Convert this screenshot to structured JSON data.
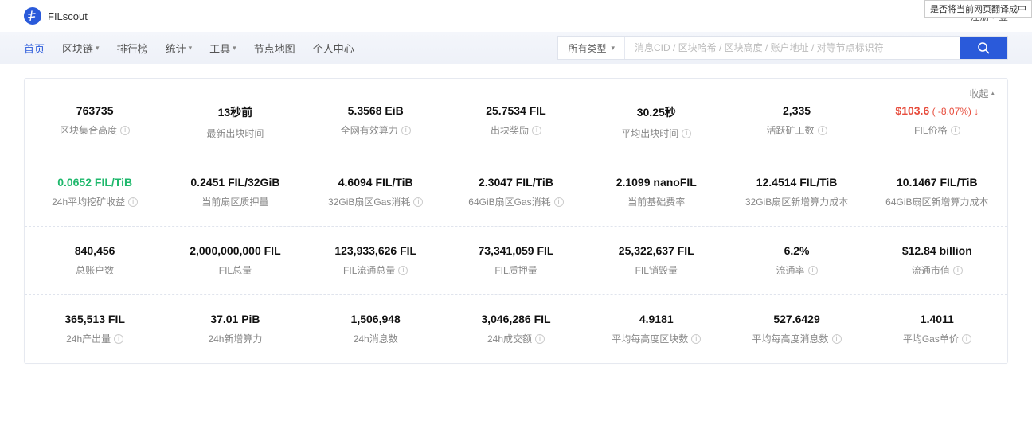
{
  "brand": {
    "name": "FILscout",
    "logo_glyph": "Ⓕ"
  },
  "top_right": {
    "register": "注册",
    "login": "登",
    "separator": "/"
  },
  "translate_prompt": "是否将当前网页翻译成中",
  "nav": {
    "home": "首页",
    "blockchain": "区块链",
    "leaderboard": "排行榜",
    "stats": "统计",
    "tools": "工具",
    "node_map": "节点地图",
    "personal": "个人中心"
  },
  "search": {
    "type_label": "所有类型",
    "placeholder": "消息CID / 区块哈希 / 区块高度 / 账户地址 / 对等节点标识符"
  },
  "collapse": {
    "label": "收起"
  },
  "stats": {
    "row1": [
      {
        "value": "763735",
        "label": "区块集合高度",
        "info": true
      },
      {
        "value": "13秒前",
        "label": "最新出块时间",
        "info": false
      },
      {
        "value": "5.3568 EiB",
        "label": "全网有效算力",
        "info": true
      },
      {
        "value": "25.7534 FIL",
        "label": "出块奖励",
        "info": true
      },
      {
        "value": "30.25秒",
        "label": "平均出块时间",
        "info": true
      },
      {
        "value": "2,335",
        "label": "活跃矿工数",
        "info": true
      },
      {
        "value": "$103.6",
        "pct": "( -8.07%) ↓",
        "label": "FIL价格",
        "info": true,
        "price": true
      }
    ],
    "row2": [
      {
        "value": "0.0652 FIL/TiB",
        "label": "24h平均挖矿收益",
        "info": true,
        "green": true
      },
      {
        "value": "0.2451 FIL/32GiB",
        "label": "当前扇区质押量",
        "info": false
      },
      {
        "value": "4.6094 FIL/TiB",
        "label": "32GiB扇区Gas消耗",
        "info": true
      },
      {
        "value": "2.3047 FIL/TiB",
        "label": "64GiB扇区Gas消耗",
        "info": true
      },
      {
        "value": "2.1099 nanoFIL",
        "label": "当前基础费率",
        "info": false
      },
      {
        "value": "12.4514 FIL/TiB",
        "label": "32GiB扇区新增算力成本",
        "info": false
      },
      {
        "value": "10.1467 FIL/TiB",
        "label": "64GiB扇区新增算力成本",
        "info": false
      }
    ],
    "row3": [
      {
        "value": "840,456",
        "label": "总账户数",
        "info": false
      },
      {
        "value": "2,000,000,000 FIL",
        "label": "FIL总量",
        "info": false
      },
      {
        "value": "123,933,626 FIL",
        "label": "FIL流通总量",
        "info": true
      },
      {
        "value": "73,341,059 FIL",
        "label": "FIL质押量",
        "info": false
      },
      {
        "value": "25,322,637 FIL",
        "label": "FIL销毁量",
        "info": false
      },
      {
        "value": "6.2%",
        "label": "流通率",
        "info": true
      },
      {
        "value": "$12.84 billion",
        "label": "流通市值",
        "info": true
      }
    ],
    "row4": [
      {
        "value": "365,513 FIL",
        "label": "24h产出量",
        "info": true
      },
      {
        "value": "37.01 PiB",
        "label": "24h新增算力",
        "info": false
      },
      {
        "value": "1,506,948",
        "label": "24h消息数",
        "info": false
      },
      {
        "value": "3,046,286 FIL",
        "label": "24h成交额",
        "info": true
      },
      {
        "value": "4.9181",
        "label": "平均每高度区块数",
        "info": true
      },
      {
        "value": "527.6429",
        "label": "平均每高度消息数",
        "info": true
      },
      {
        "value": "1.4011",
        "label": "平均Gas单价",
        "info": true
      }
    ]
  }
}
